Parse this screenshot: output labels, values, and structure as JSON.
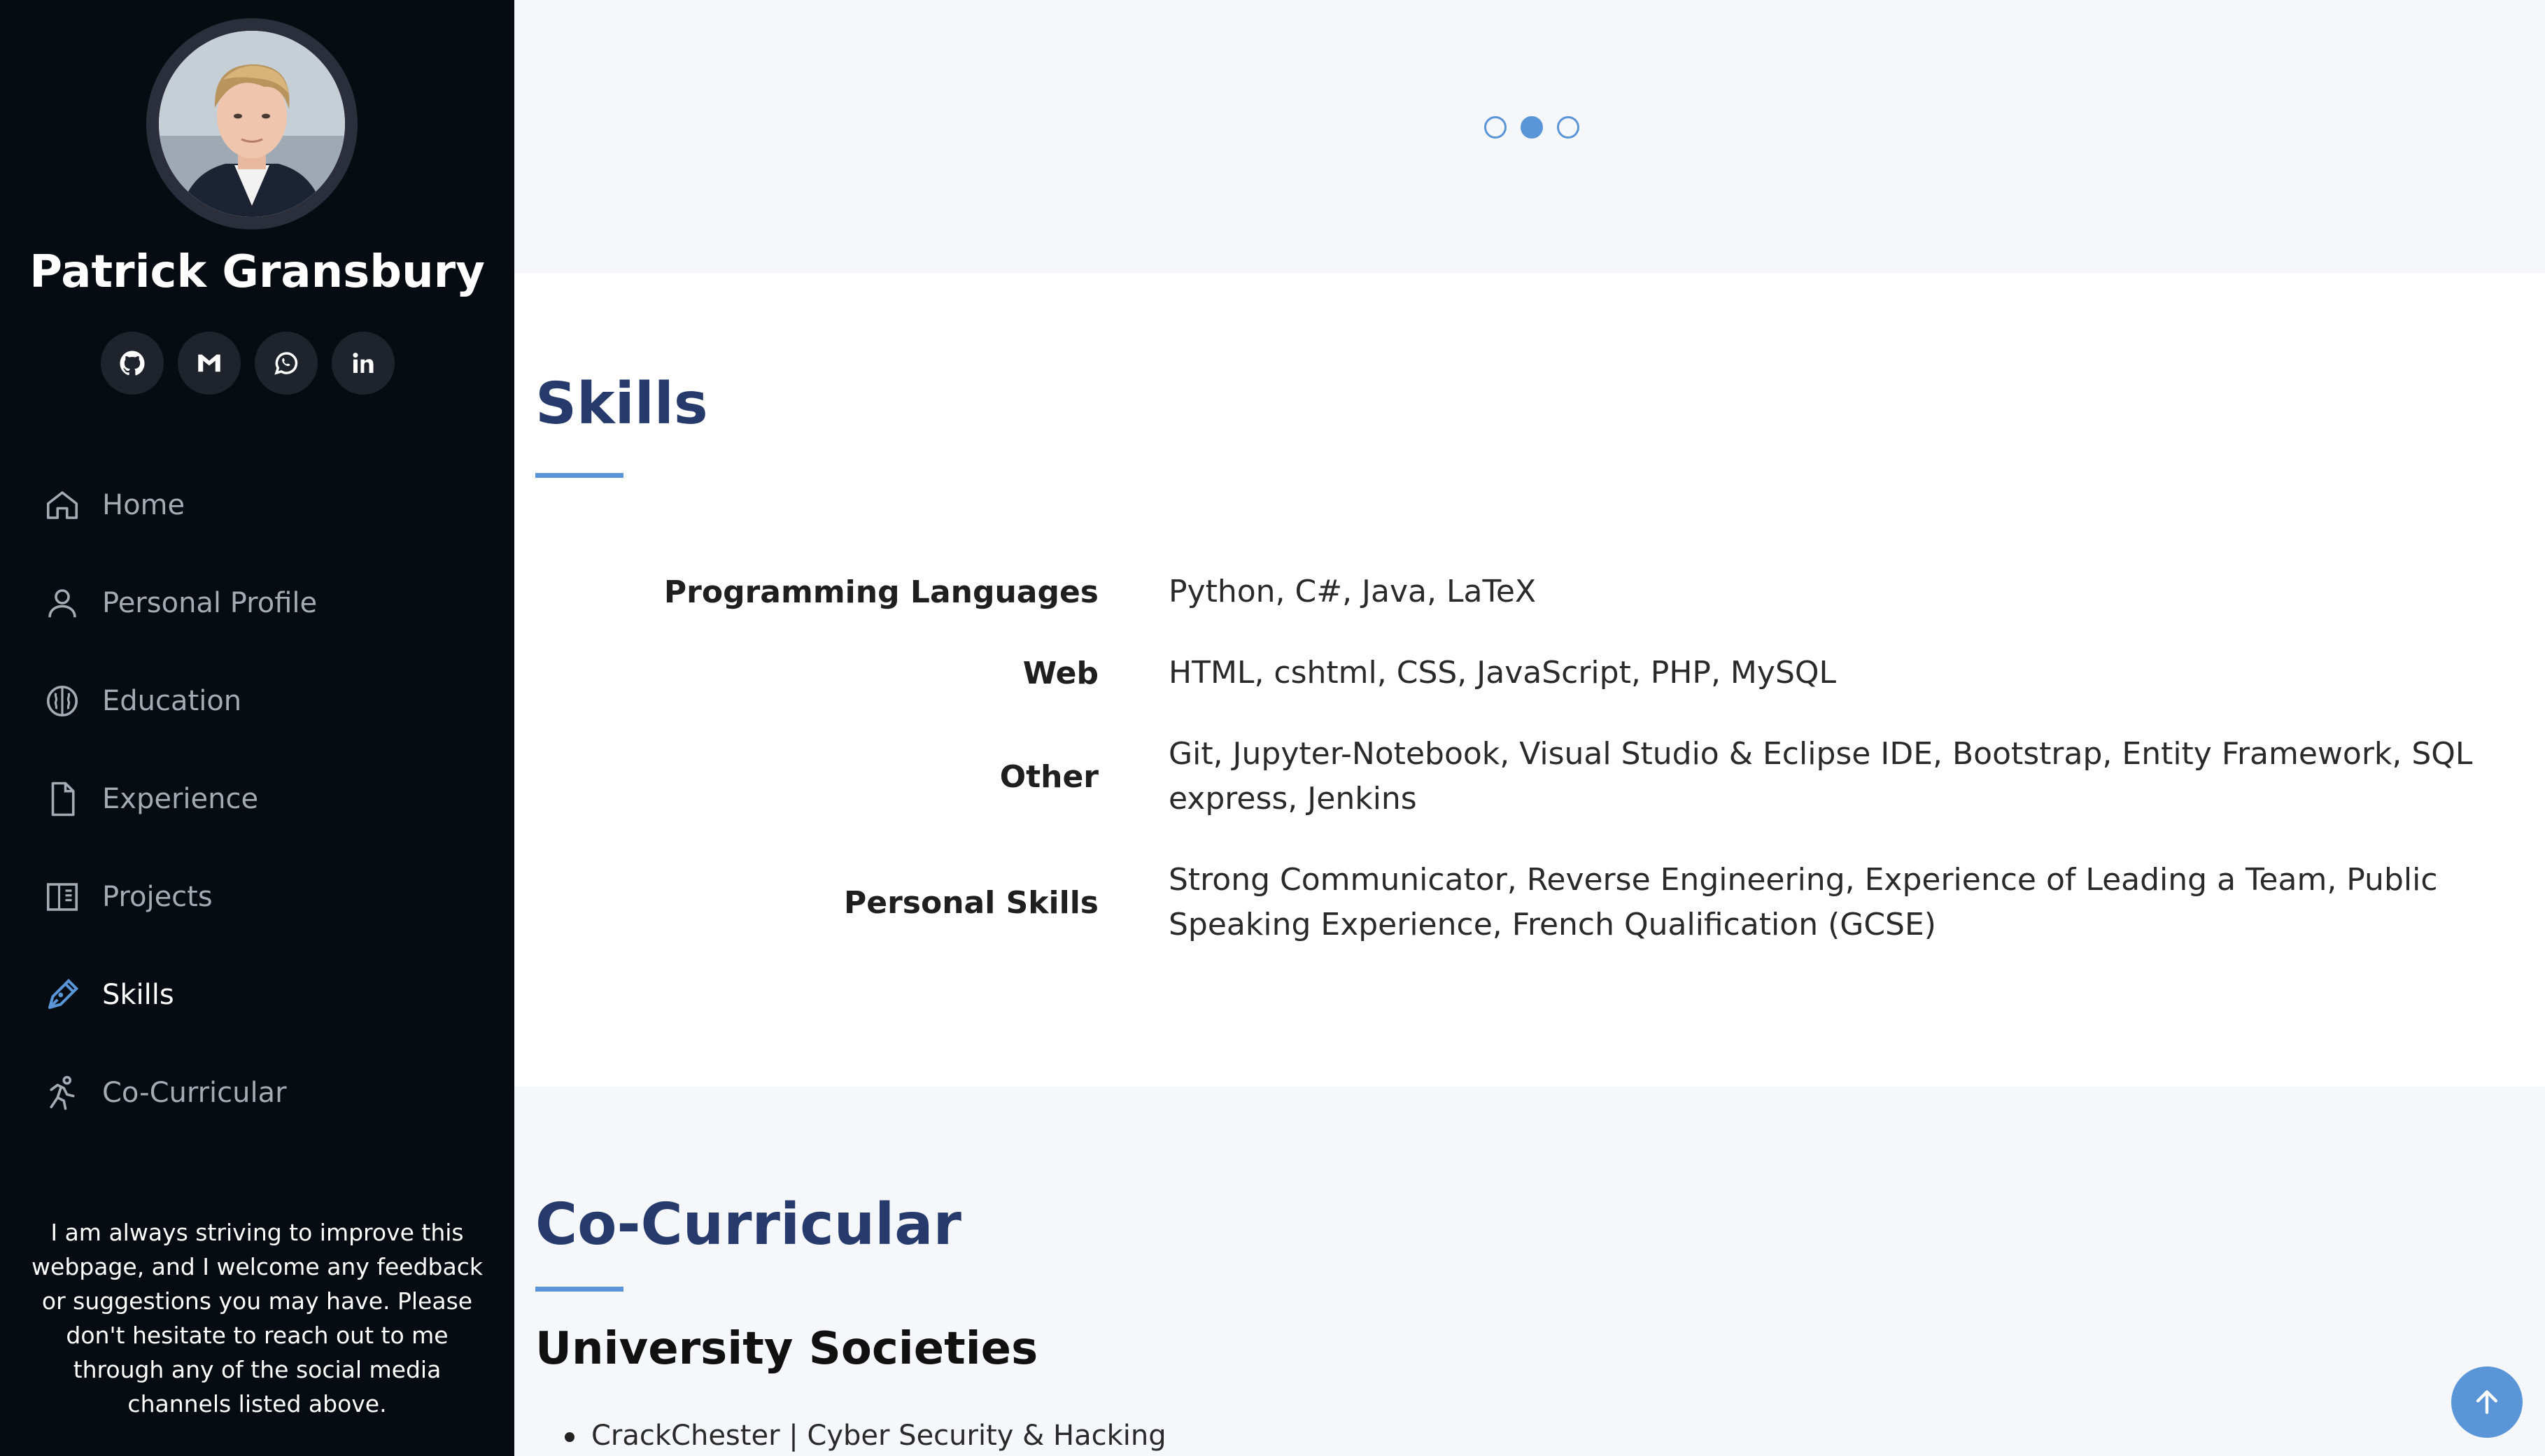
{
  "profile": {
    "name": "Patrick Gransbury",
    "avatar_alt": "profile-photo"
  },
  "socials": [
    {
      "icon": "github-icon"
    },
    {
      "icon": "gmail-icon"
    },
    {
      "icon": "whatsapp-icon"
    },
    {
      "icon": "linkedin-icon"
    }
  ],
  "nav": {
    "items": [
      {
        "label": "Home",
        "icon": "home-icon"
      },
      {
        "label": "Personal Profile",
        "icon": "person-icon"
      },
      {
        "label": "Education",
        "icon": "brain-icon"
      },
      {
        "label": "Experience",
        "icon": "file-icon"
      },
      {
        "label": "Projects",
        "icon": "book-icon"
      },
      {
        "label": "Skills",
        "icon": "pen-icon",
        "active": true
      },
      {
        "label": "Co-Curricular",
        "icon": "running-icon"
      }
    ]
  },
  "sidebar_note": "I am always striving to improve this webpage, and I welcome any feedback or suggestions you may have. Please don't hesitate to reach out to me through any of the social media channels listed above.",
  "carousel": {
    "dot_count": 3,
    "active_index": 1
  },
  "skills": {
    "title": "Skills",
    "rows": [
      {
        "label": "Programming Languages",
        "value": "Python, C#, Java, LaTeX"
      },
      {
        "label": "Web",
        "value": "HTML, cshtml, CSS, JavaScript, PHP, MySQL"
      },
      {
        "label": "Other",
        "value": "Git, Jupyter-Notebook, Visual Studio & Eclipse IDE, Bootstrap, Entity Framework, SQL express, Jenkins"
      },
      {
        "label": "Personal Skills",
        "value": "Strong Communicator, Reverse Engineering, Experience of Leading a Team, Public Speaking Experience, French Qualification (GCSE)"
      }
    ]
  },
  "cocurricular": {
    "title": "Co-Curricular",
    "subheading": "University Societies",
    "items": [
      "CrackChester | Cyber Security & Hacking"
    ]
  },
  "colors": {
    "sidebar_bg": "#070b12",
    "accent": "#5a95d8",
    "heading": "#263a6b"
  }
}
